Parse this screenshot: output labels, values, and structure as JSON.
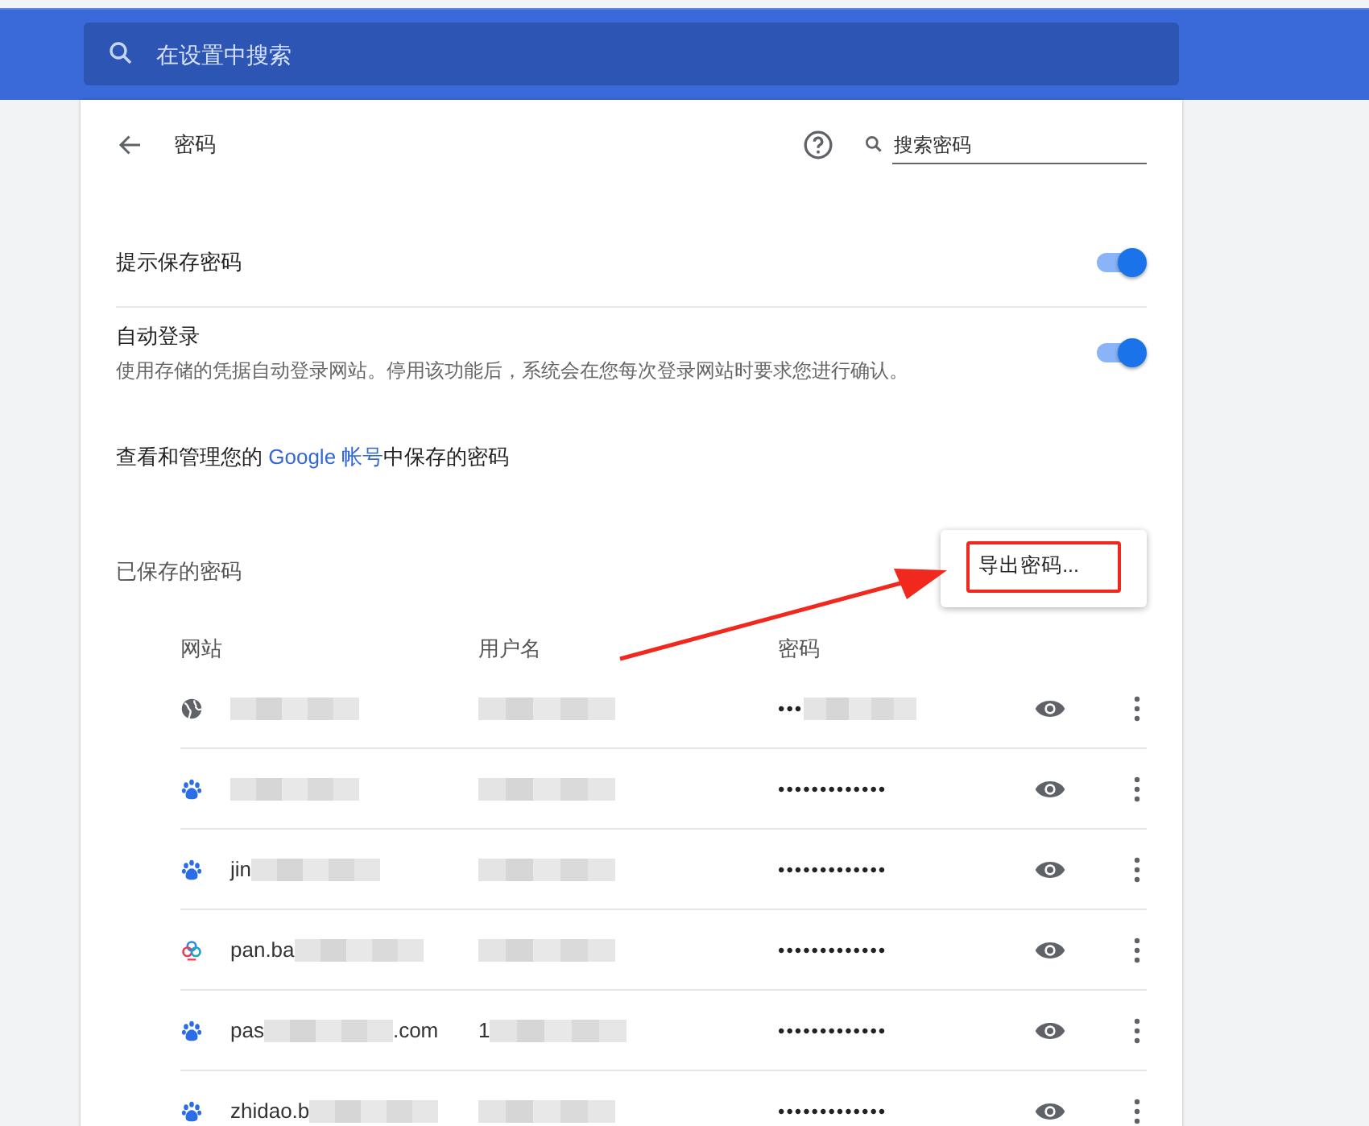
{
  "search": {
    "placeholder": "在设置中搜索"
  },
  "header": {
    "title": "密码",
    "search_placeholder": "搜索密码"
  },
  "settings": [
    {
      "label": "提示保存密码",
      "on": true
    },
    {
      "label": "自动登录",
      "description": "使用存储的凭据自动登录网站。停用该功能后，系统会在您每次登录网站时要求您进行确认。",
      "on": true
    }
  ],
  "account_note": {
    "before": "查看和管理您的 ",
    "link": "Google 帐号",
    "after": "中保存的密码"
  },
  "saved_title": "已保存的密码",
  "export_menu": {
    "items": [
      "导出密码..."
    ]
  },
  "table": {
    "columns": [
      "网站",
      "用户名",
      "密码"
    ],
    "rows": [
      {
        "kind": "globe",
        "site": {
          "redacted": true
        },
        "username": {
          "redacted": true
        },
        "password": {
          "text": "•••",
          "redacted": true
        }
      },
      {
        "kind": "paw",
        "site": {
          "redacted": true
        },
        "username": {
          "redacted": true
        },
        "password": {
          "text": "•••••••••••••",
          "redacted": false
        }
      },
      {
        "kind": "paw",
        "site": {
          "text": "jin",
          "redacted": true
        },
        "username": {
          "redacted": true
        },
        "password": {
          "text": "•••••••••••••",
          "redacted": false
        }
      },
      {
        "kind": "cloud",
        "site": {
          "text": "pan.ba",
          "redacted": true
        },
        "username": {
          "redacted": true
        },
        "password": {
          "text": "•••••••••••••",
          "redacted": false
        }
      },
      {
        "kind": "paw",
        "site": {
          "text": "pas",
          "redacted": true,
          "after": ".com"
        },
        "username": {
          "text": "1",
          "redacted": true
        },
        "password": {
          "text": "•••••••••••••",
          "redacted": false
        }
      },
      {
        "kind": "paw",
        "site": {
          "text": "zhidao.b",
          "redacted": true
        },
        "username": {
          "redacted": true
        },
        "password": {
          "text": "•••••••••••••",
          "redacted": false
        }
      }
    ]
  }
}
